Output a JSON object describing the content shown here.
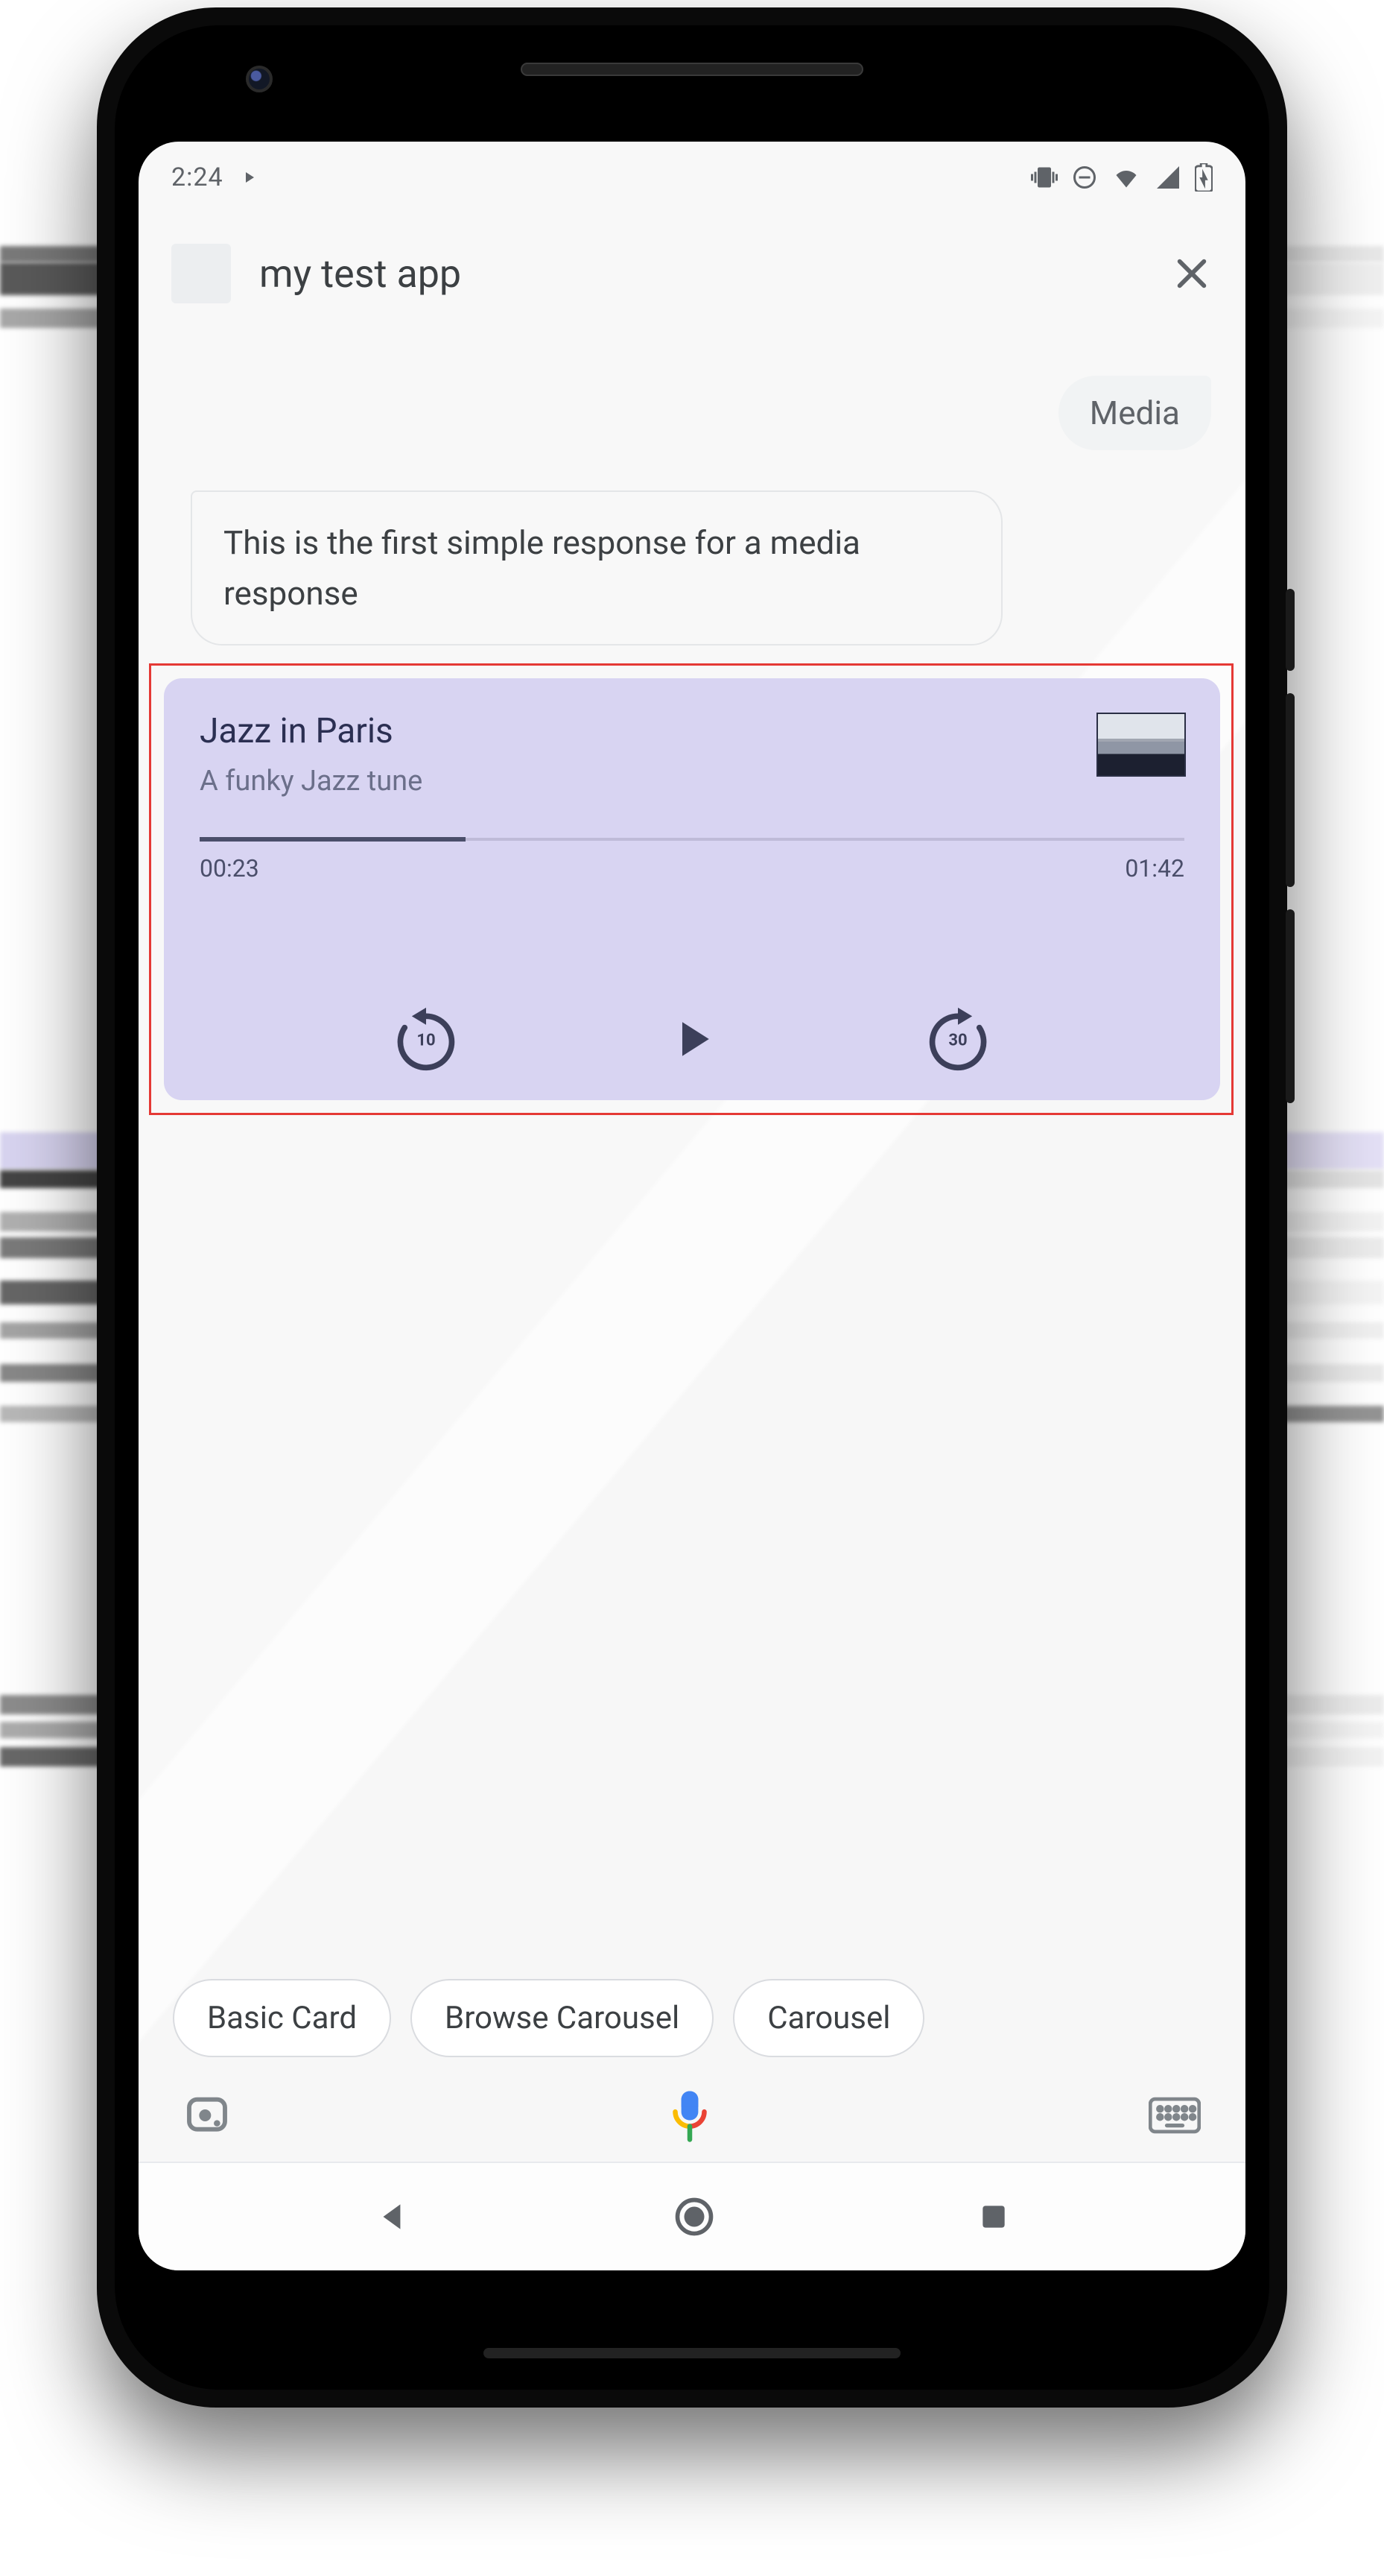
{
  "status_bar": {
    "time": "2:24"
  },
  "header": {
    "app_name": "my test app"
  },
  "conversation": {
    "user_message": "Media",
    "bot_message": "This is the first simple response for a media response"
  },
  "media_card": {
    "title": "Jazz in Paris",
    "subtitle": "A funky Jazz tune",
    "elapsed": "00:23",
    "duration": "01:42",
    "rewind_seconds": "10",
    "forward_seconds": "30",
    "progress_percent": 27
  },
  "suggestion_chips": [
    "Basic Card",
    "Browse Carousel",
    "Carousel"
  ]
}
